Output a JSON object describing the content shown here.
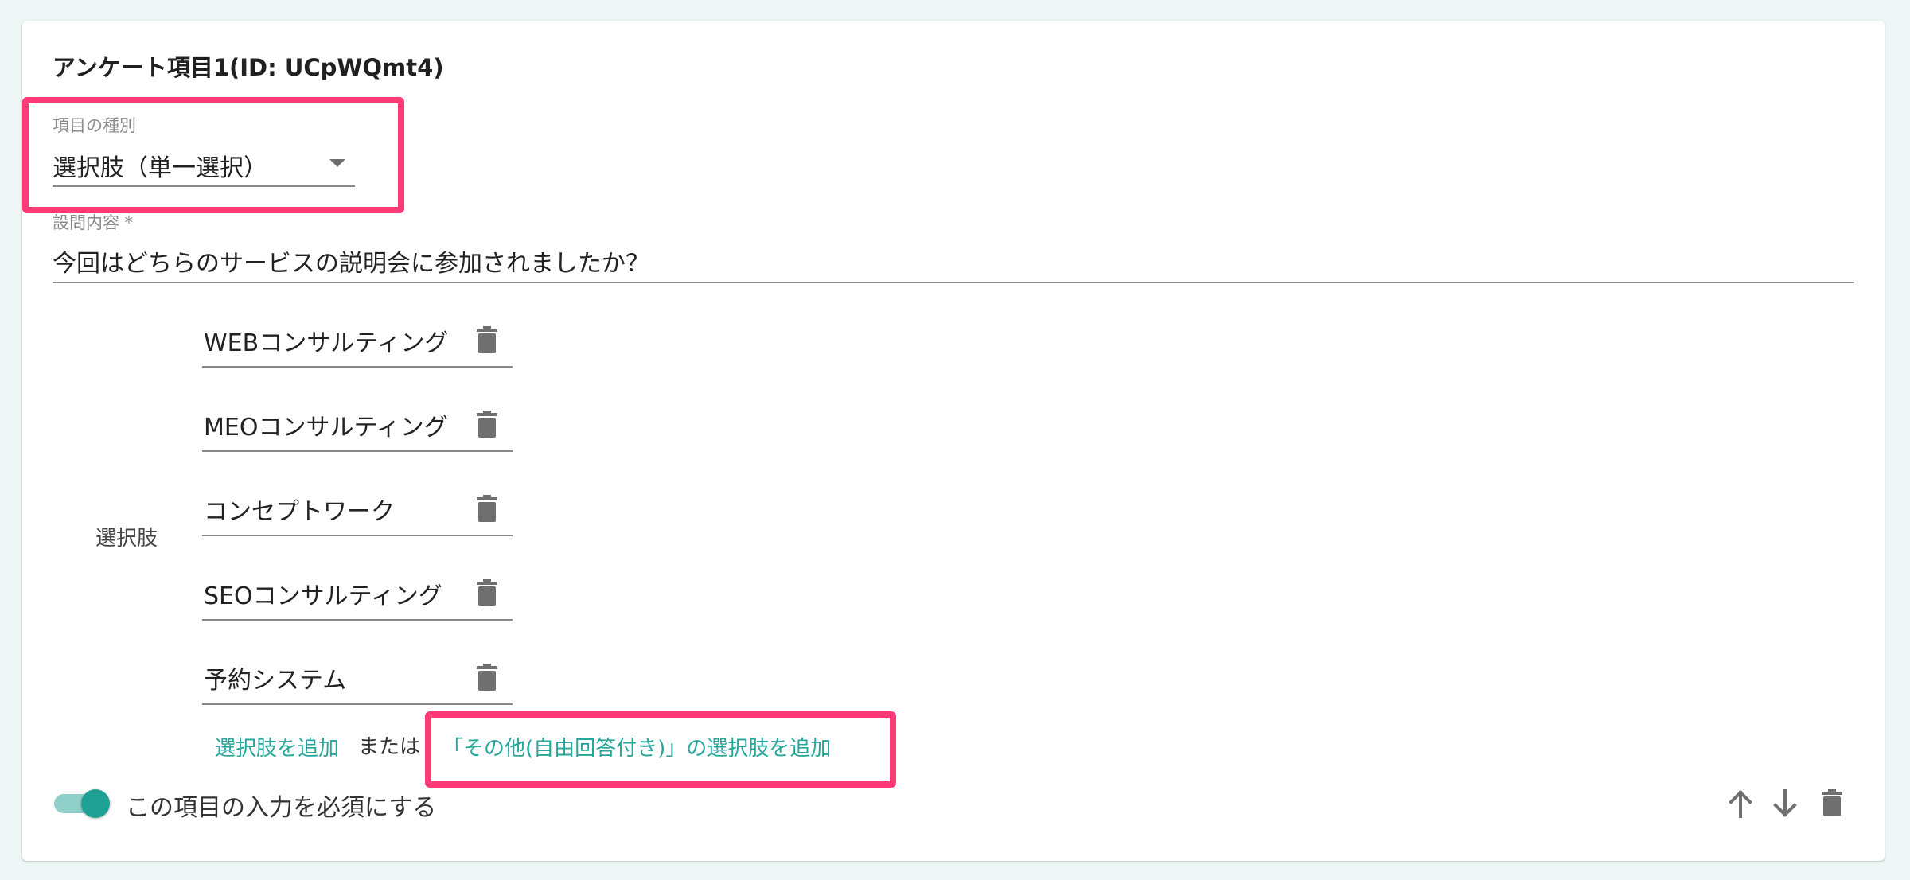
{
  "item": {
    "title": "アンケート項目1(ID: UCpWQmt4)",
    "type_label": "項目の種別",
    "type_value": "選択肢（単一選択）",
    "question_label": "設問内容 *",
    "question_value": "今回はどちらのサービスの説明会に参加されましたか？",
    "choices_label": "選択肢",
    "choices": [
      {
        "label": "WEBコンサルティング"
      },
      {
        "label": "MEOコンサルティング"
      },
      {
        "label": "コンセプトワーク"
      },
      {
        "label": "SEOコンサルティング"
      },
      {
        "label": "予約システム"
      }
    ],
    "add_choice_link": "選択肢を追加",
    "or_text": "または",
    "add_other_link": "「その他(自由回答付き)」の選択肢を追加",
    "required_label": "この項目の入力を必須にする",
    "required_on": true
  },
  "icons": {
    "delete": "trash-icon",
    "move_up": "arrow-up-icon",
    "move_down": "arrow-down-icon",
    "dropdown": "triangle-down-icon"
  },
  "colors": {
    "accent": "#26a69a",
    "highlight": "#ff3b77",
    "icon": "#6f6f6f"
  }
}
